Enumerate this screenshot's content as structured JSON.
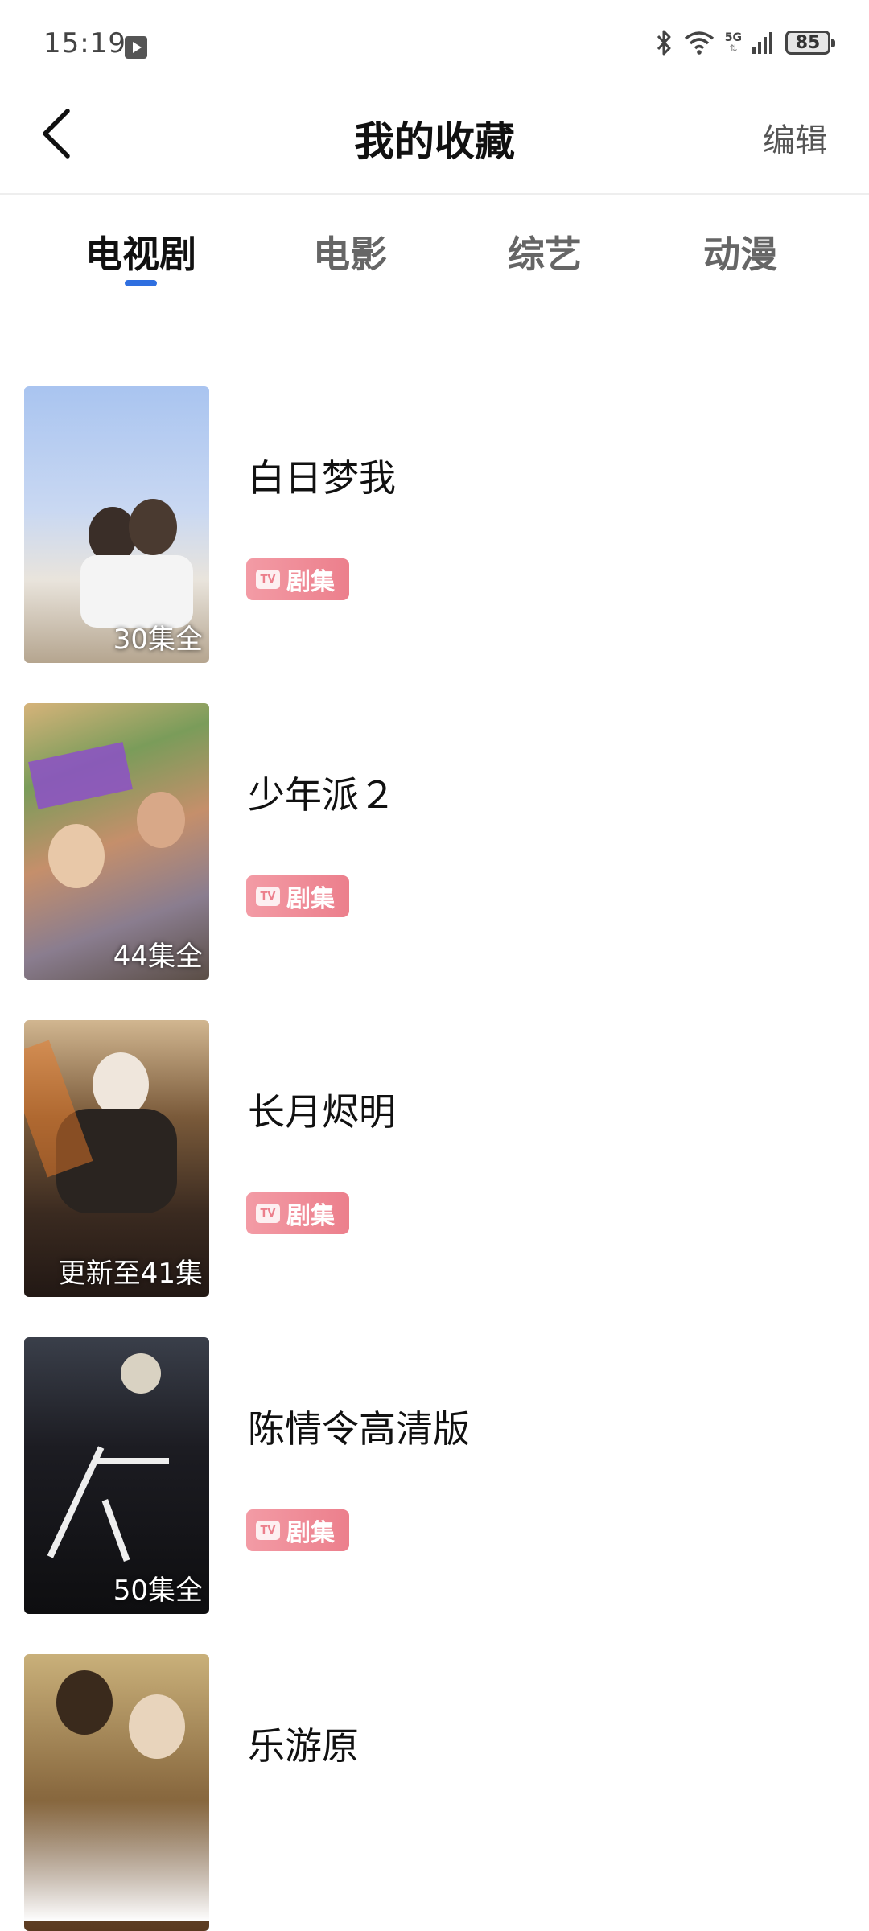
{
  "status_bar": {
    "time": "15:19",
    "network": "5G",
    "battery": "85",
    "icons": [
      "play-icon",
      "bluetooth-icon",
      "wifi-icon",
      "signal-icon",
      "battery-icon"
    ]
  },
  "header": {
    "title": "我的收藏",
    "edit_label": "编辑",
    "back_icon": "chevron-left-icon"
  },
  "tabs": [
    {
      "label": "电视剧",
      "active": true
    },
    {
      "label": "电影",
      "active": false
    },
    {
      "label": "综艺",
      "active": false
    },
    {
      "label": "动漫",
      "active": false
    }
  ],
  "accent_color": "#2f6fe0",
  "tag_color": "#ec7f8c",
  "items": [
    {
      "title": "白日梦我",
      "badge": "30集全",
      "tag": "剧集",
      "tag_icon": "TV"
    },
    {
      "title": "少年派２",
      "badge": "44集全",
      "tag": "剧集",
      "tag_icon": "TV"
    },
    {
      "title": "长月烬明",
      "badge": "更新至41集",
      "tag": "剧集",
      "tag_icon": "TV"
    },
    {
      "title": "陈情令高清版",
      "badge": "50集全",
      "tag": "剧集",
      "tag_icon": "TV"
    },
    {
      "title": "乐游原",
      "badge": "",
      "tag": "",
      "tag_icon": ""
    }
  ]
}
